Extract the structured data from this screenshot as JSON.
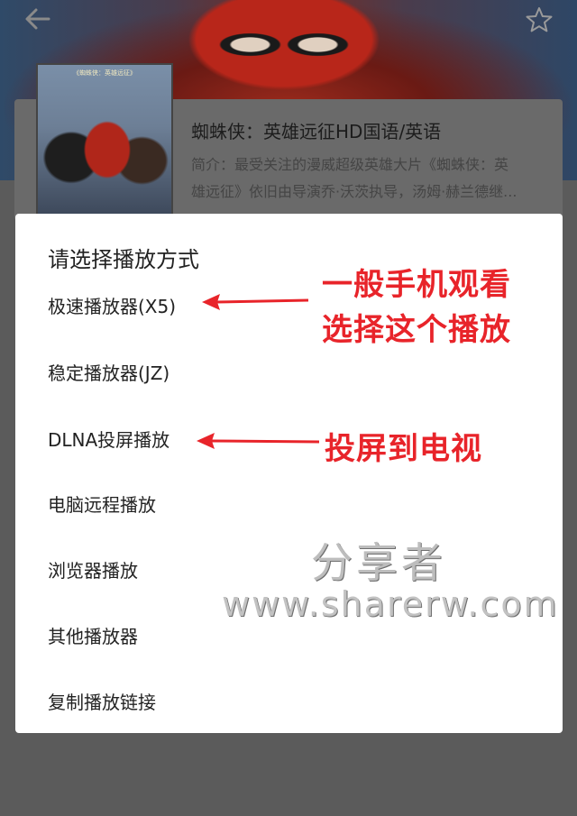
{
  "movie": {
    "poster_title": "《蜘蛛侠：英雄远征》",
    "title": "蜘蛛侠：英雄远征HD国语/英语",
    "desc_line1": "简介：最受关注的漫威超级英雄大片《蜘蛛侠：英",
    "desc_line2": "雄远征》依旧由导演乔·沃茨执导，汤姆·赫兰德继..."
  },
  "dialog": {
    "title": "请选择播放方式",
    "options": [
      {
        "label": "极速播放器(X5)"
      },
      {
        "label": "稳定播放器(JZ)"
      },
      {
        "label": "DLNA投屏播放"
      },
      {
        "label": "电脑远程播放"
      },
      {
        "label": "浏览器播放"
      },
      {
        "label": "其他播放器"
      },
      {
        "label": "复制播放链接"
      }
    ]
  },
  "annotations": {
    "note1_line1": "一般手机观看",
    "note1_line2": "选择这个播放",
    "note2": "投屏到电视",
    "color": "#e8242a"
  },
  "watermark": {
    "name": "分享者",
    "url": "www.sharerw.com"
  },
  "icons": {
    "back": "back-arrow-icon",
    "favorite": "star-icon"
  }
}
